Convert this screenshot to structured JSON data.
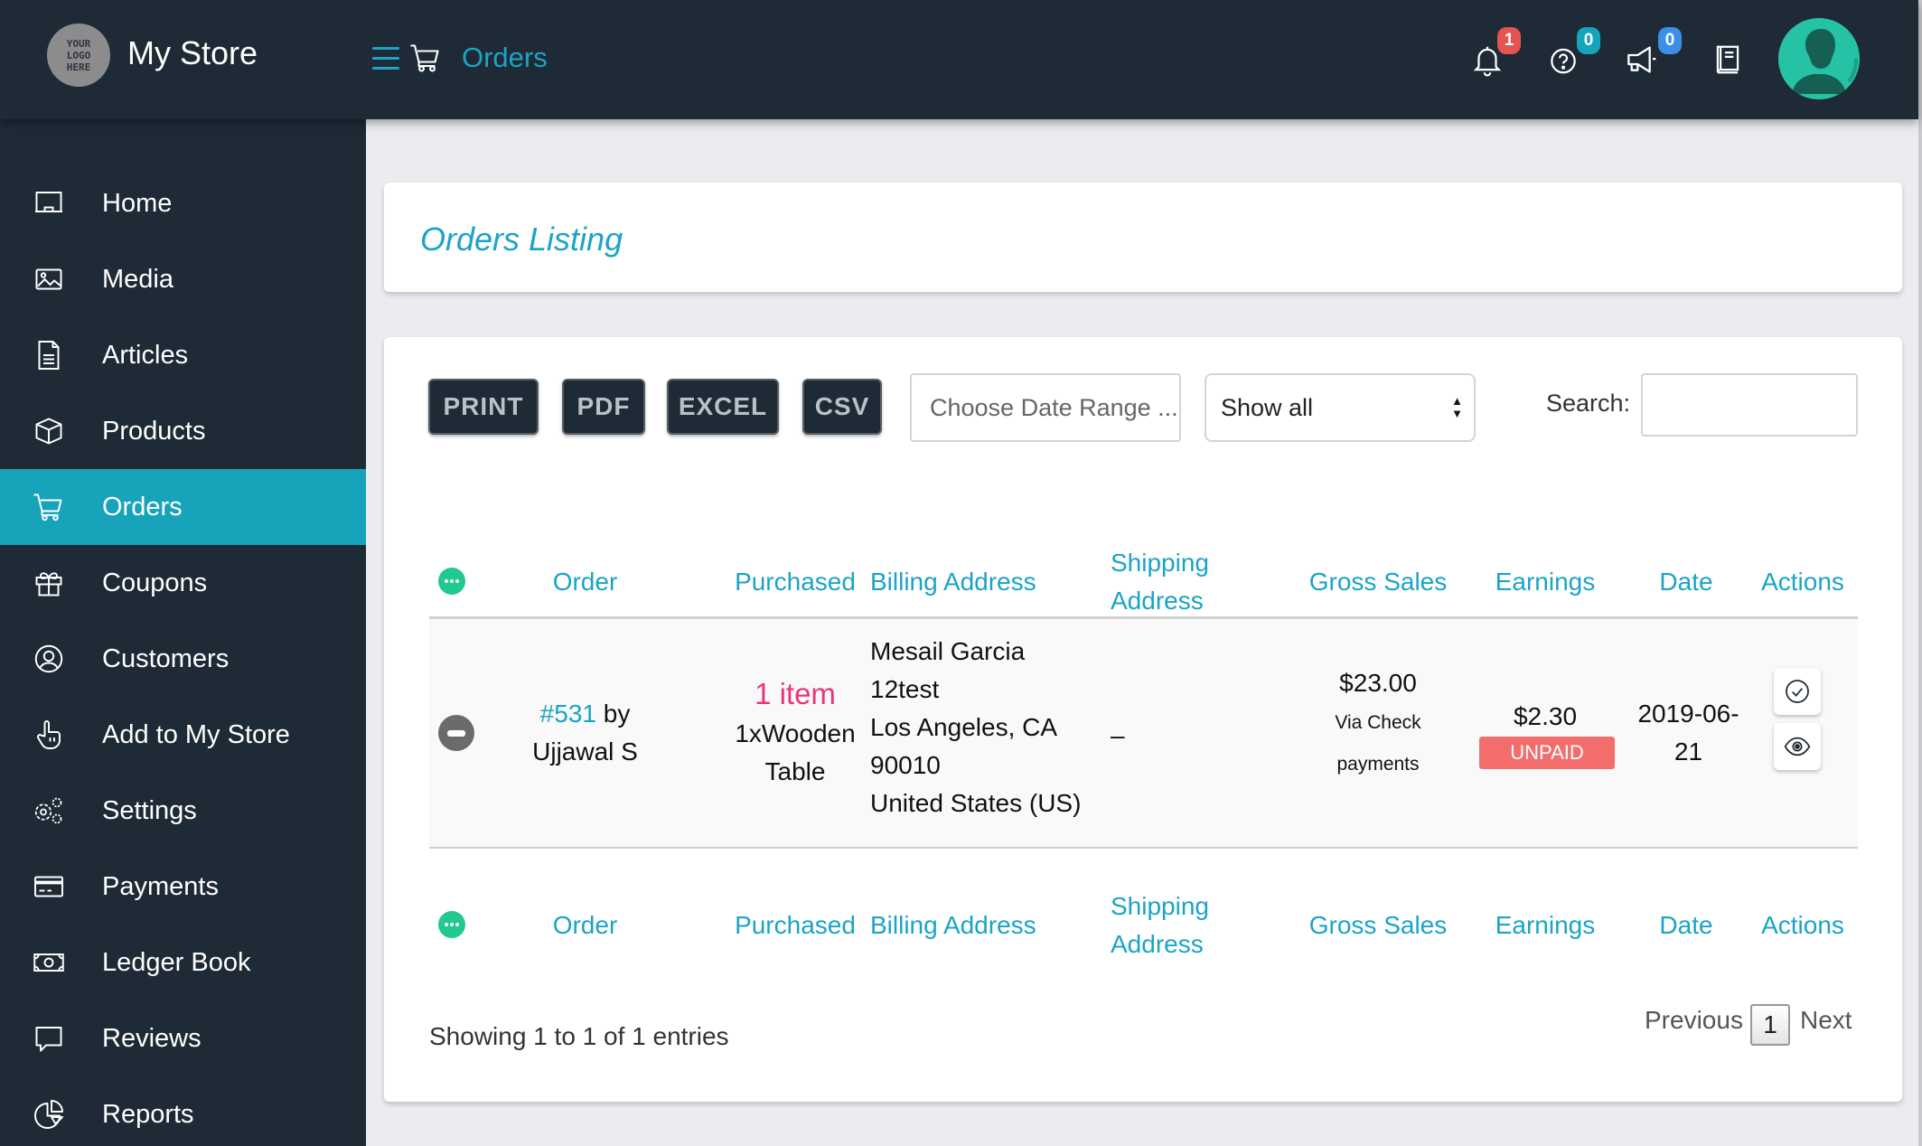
{
  "header": {
    "logo_lines": [
      "YOUR",
      "LOGO",
      "HERE"
    ],
    "store_name": "My Store",
    "page": "Orders",
    "icons": [
      {
        "name": "bell-icon",
        "badge": "1",
        "badge_color": "#e55353"
      },
      {
        "name": "help-icon",
        "badge": "0",
        "badge_color": "#17a4ba"
      },
      {
        "name": "megaphone-icon",
        "badge": "0",
        "badge_color": "#3b8fe8"
      },
      {
        "name": "book-icon"
      }
    ],
    "avatar": "user-avatar"
  },
  "sidebar": {
    "items": [
      {
        "label": "Home",
        "icon": "home-icon"
      },
      {
        "label": "Media",
        "icon": "image-icon"
      },
      {
        "label": "Articles",
        "icon": "document-icon"
      },
      {
        "label": "Products",
        "icon": "box-icon"
      },
      {
        "label": "Orders",
        "icon": "cart-icon",
        "active": true
      },
      {
        "label": "Coupons",
        "icon": "gift-icon"
      },
      {
        "label": "Customers",
        "icon": "user-circle-icon"
      },
      {
        "label": "Add to My Store",
        "icon": "hand-pointer-icon"
      },
      {
        "label": "Settings",
        "icon": "gears-icon"
      },
      {
        "label": "Payments",
        "icon": "credit-card-icon"
      },
      {
        "label": "Ledger Book",
        "icon": "money-bill-icon"
      },
      {
        "label": "Reviews",
        "icon": "comment-icon"
      },
      {
        "label": "Reports",
        "icon": "pie-chart-icon"
      }
    ]
  },
  "title": "Orders Listing",
  "toolbar": {
    "buttons": [
      "PRINT",
      "PDF",
      "EXCEL",
      "CSV"
    ],
    "date_range_placeholder": "Choose Date Range ...",
    "filter_selected": "Show all",
    "search_label": "Search:",
    "search_value": ""
  },
  "table": {
    "columns": [
      "Order",
      "Purchased",
      "Billing Address",
      "Shipping Address",
      "Gross Sales",
      "Earnings",
      "Date",
      "Actions"
    ],
    "rows": [
      {
        "order_id": "#531",
        "order_by": "by",
        "customer": "Ujjawal S",
        "purchased_count": "1 item",
        "purchased_item": "1xWooden Table",
        "billing_address": [
          "Mesail Garcia",
          "12test",
          "Los Angeles, CA",
          "90010",
          "United States (US)"
        ],
        "shipping_address": "–",
        "gross_sales": "$23.00",
        "payment_method": "Via Check payments",
        "earnings": "$2.30",
        "earnings_status": "UNPAID",
        "date": "2019-06-21",
        "actions": [
          "mark-complete",
          "view"
        ]
      }
    ]
  },
  "footer": {
    "showing": "Showing 1 to 1 of 1 entries",
    "previous": "Previous",
    "current_page": "1",
    "next": "Next"
  },
  "colors": {
    "accent": "#1ba4c6",
    "sidebar_bg": "#1e2a36",
    "active_item": "#17a4ba",
    "unpaid": "#f46d6d",
    "purchased_count": "#e8367d"
  }
}
